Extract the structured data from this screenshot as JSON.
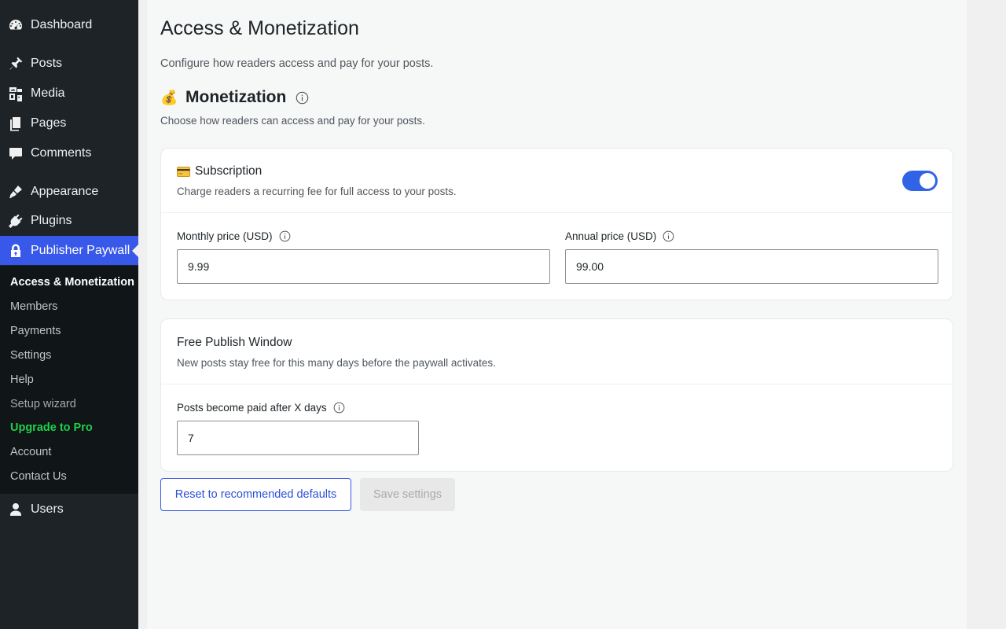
{
  "sidebar": {
    "items": [
      {
        "label": "Dashboard",
        "icon": "dashboard-icon"
      },
      {
        "label": "Posts",
        "icon": "pin-icon"
      },
      {
        "label": "Media",
        "icon": "media-icon"
      },
      {
        "label": "Pages",
        "icon": "pages-icon"
      },
      {
        "label": "Comments",
        "icon": "comment-icon"
      },
      {
        "label": "Appearance",
        "icon": "brush-icon"
      },
      {
        "label": "Plugins",
        "icon": "plugin-icon"
      },
      {
        "label": "Publisher Paywall",
        "icon": "lock-icon"
      },
      {
        "label": "Users",
        "icon": "user-icon"
      }
    ],
    "submenu": [
      {
        "label": "Access & Monetization"
      },
      {
        "label": "Members"
      },
      {
        "label": "Payments"
      },
      {
        "label": "Settings"
      },
      {
        "label": "Help"
      },
      {
        "label": "Setup wizard"
      },
      {
        "label": "Upgrade to Pro"
      },
      {
        "label": "Account"
      },
      {
        "label": "Contact Us"
      }
    ],
    "accent_color": "#3858e9"
  },
  "page": {
    "title": "Access & Monetization",
    "description": "Configure how readers access and pay for your posts."
  },
  "monetization": {
    "title": "Monetization",
    "description": "Choose how readers can access and pay for your posts."
  },
  "subscription": {
    "title": "Subscription",
    "description": "Charge readers a recurring fee for full access to your posts.",
    "enabled": true,
    "monthly_label": "Monthly price (USD)",
    "monthly_value": "9.99",
    "annual_label": "Annual price (USD)",
    "annual_value": "99.00"
  },
  "free_window": {
    "title": "Free Publish Window",
    "description": "New posts stay free for this many days before the paywall activates.",
    "days_label": "Posts become paid after X days",
    "days_value": "7"
  },
  "actions": {
    "reset_label": "Reset to recommended defaults",
    "save_label": "Save settings"
  }
}
